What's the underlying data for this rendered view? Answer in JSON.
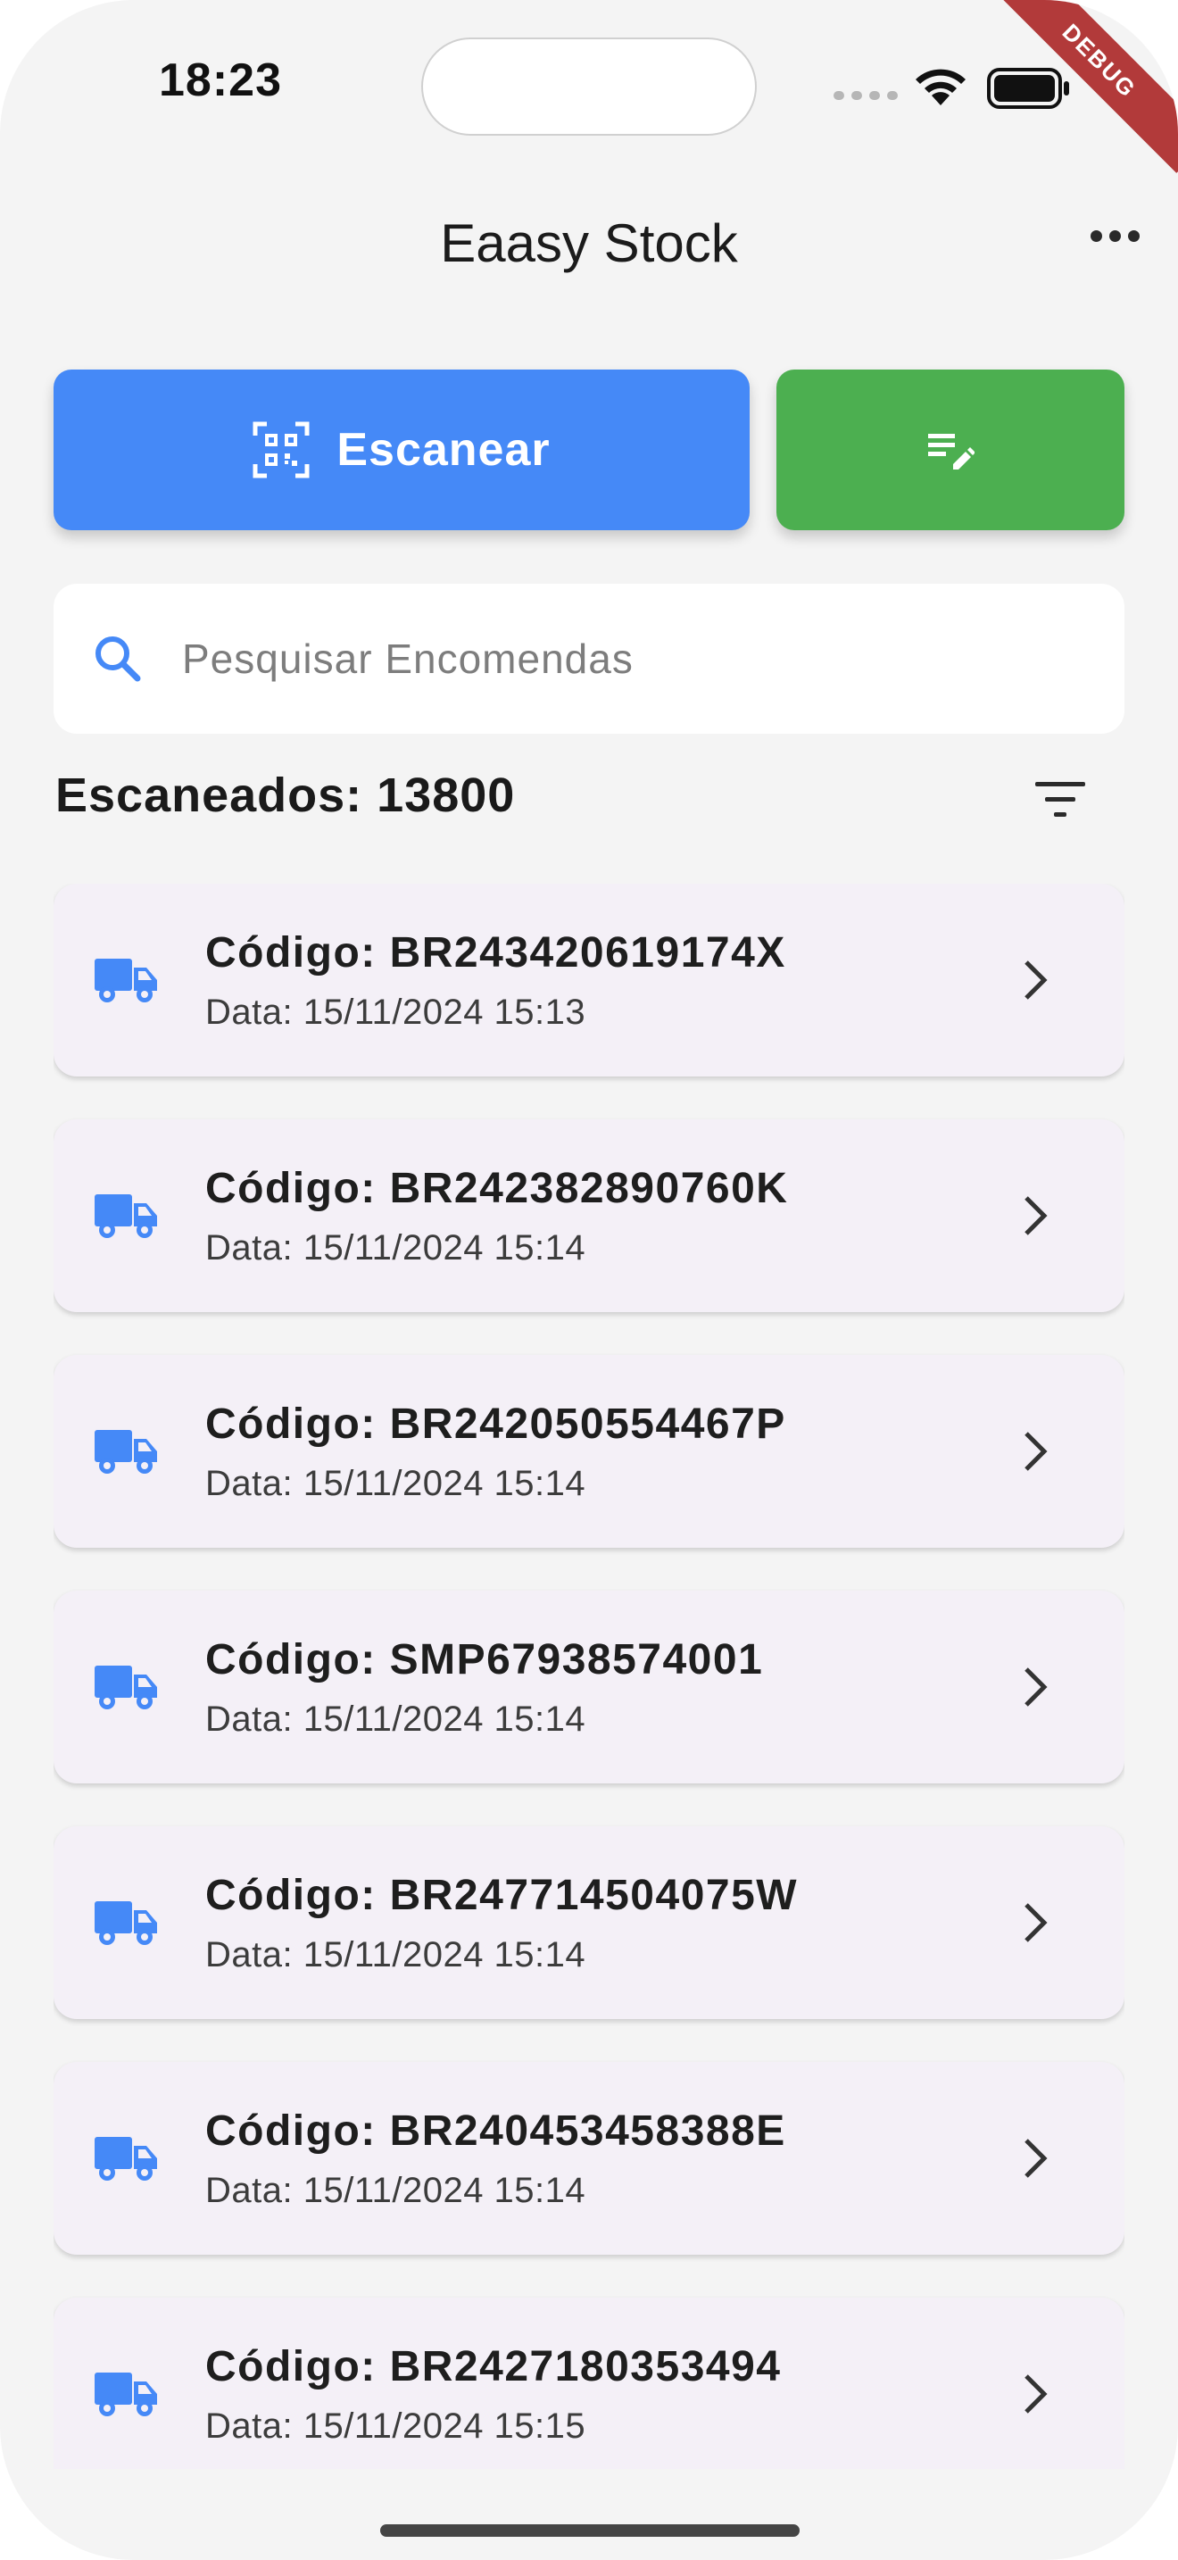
{
  "status_bar": {
    "time": "18:23",
    "debug_label": "DEBUG"
  },
  "app_bar": {
    "title": "Eaasy Stock"
  },
  "actions": {
    "scan_label": "Escanear"
  },
  "search": {
    "placeholder": "Pesquisar Encomendas",
    "value": ""
  },
  "summary": {
    "scanned_text": "Escaneados: 13800"
  },
  "colors": {
    "scan_button": "#4589f7",
    "edit_button": "#4caf50",
    "truck_icon": "#4589f7"
  },
  "items": [
    {
      "code": "Código: BR243420619174X",
      "date": "Data: 15/11/2024 15:13"
    },
    {
      "code": "Código: BR242382890760K",
      "date": "Data: 15/11/2024 15:14"
    },
    {
      "code": "Código: BR242050554467P",
      "date": "Data: 15/11/2024 15:14"
    },
    {
      "code": "Código: SMP67938574001",
      "date": "Data: 15/11/2024 15:14"
    },
    {
      "code": "Código: BR247714504075W",
      "date": "Data: 15/11/2024 15:14"
    },
    {
      "code": "Código: BR240453458388E",
      "date": "Data: 15/11/2024 15:14"
    },
    {
      "code": "Código: BR2427180353494",
      "date": "Data: 15/11/2024 15:15"
    }
  ]
}
